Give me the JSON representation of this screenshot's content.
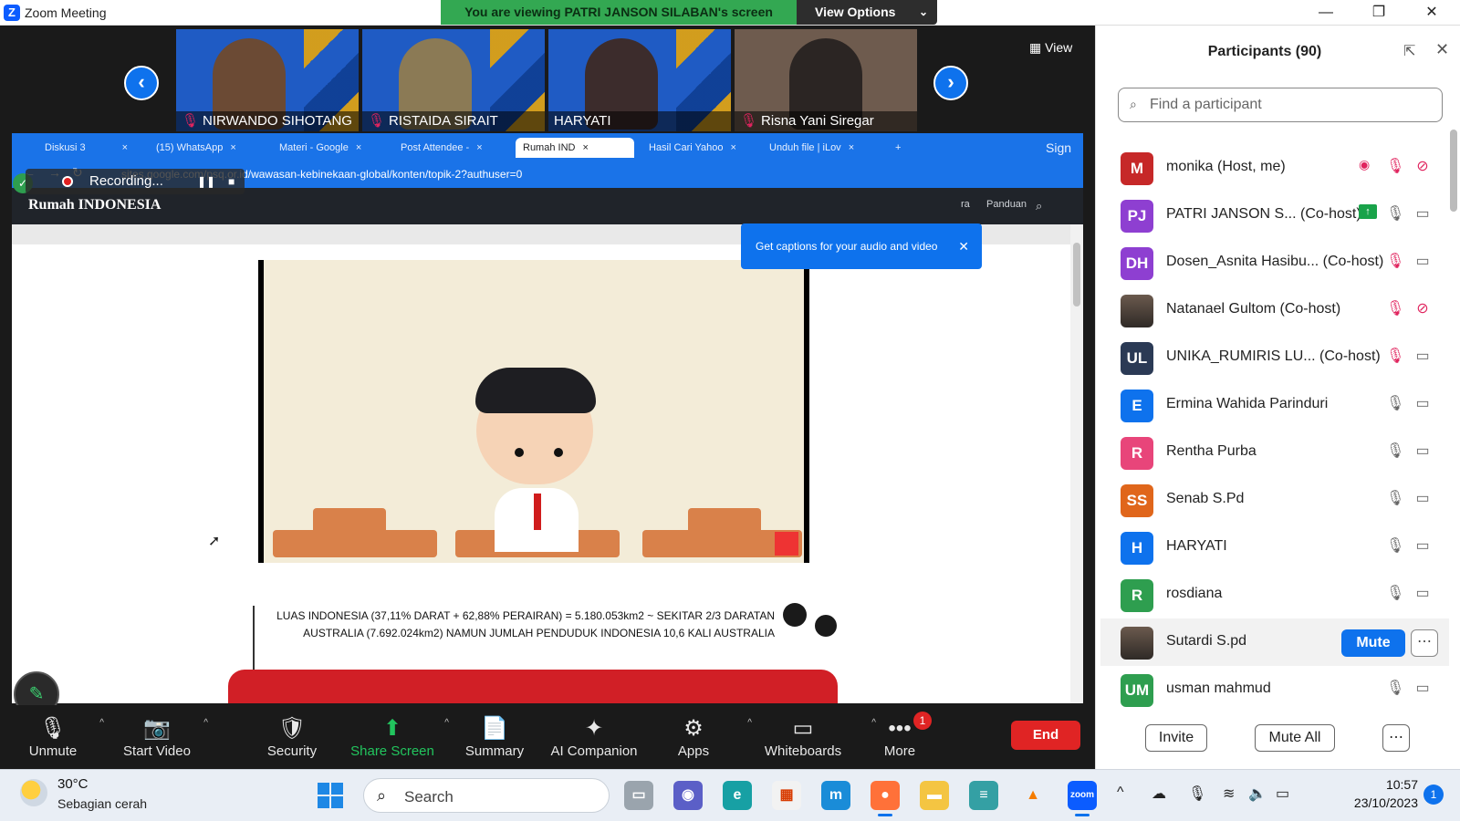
{
  "window": {
    "title": "Zoom Meeting",
    "viewing_banner": "You are viewing PATRI JANSON SILABAN's screen",
    "view_options": "View Options"
  },
  "stage": {
    "view_label": "View",
    "thumbnails": [
      {
        "name": "NIRWANDO SIHOTANG",
        "muted": true
      },
      {
        "name": "RISTAIDA SIRAIT",
        "muted": true
      },
      {
        "name": "HARYATI",
        "muted": false
      },
      {
        "name": "Risna Yani Siregar",
        "muted": true
      }
    ],
    "recording_label": "Recording...",
    "captions_tip": "Get captions for your audio and video"
  },
  "browser": {
    "tabs": [
      "Diskusi 3",
      "(15) WhatsApp",
      "Materi - Google",
      "Post Attendee -",
      "Rumah IND",
      "Hasil Cari Yahoo",
      "Unduh file | iLov"
    ],
    "sign_in": "Sign in",
    "url": "sites.google.com/psq.or.id/wawasan-kebinekaan-global/konten/topik-2?authuser=0",
    "site_brand": "Rumah INDONESIA",
    "site_links": [
      "ra",
      "Panduan"
    ],
    "slide_text_line1": "LUAS INDONESIA (37,11% DARAT + 62,88% PERAIRAN) = 5.180.053km2 ~ SEKITAR 2/3 DARATAN",
    "slide_text_line2": "AUSTRALIA (7.692.024km2) NAMUN JUMLAH PENDUDUK INDONESIA 10,6 KALI AUSTRALIA"
  },
  "toolbar": {
    "unmute": "Unmute",
    "start_video": "Start Video",
    "security": "Security",
    "share_screen": "Share Screen",
    "summary": "Summary",
    "ai_companion": "AI Companion",
    "apps": "Apps",
    "whiteboards": "Whiteboards",
    "more": "More",
    "more_badge": "1",
    "end": "End"
  },
  "participants": {
    "title": "Participants (90)",
    "search_placeholder": "Find a participant",
    "list": [
      {
        "initials": "M",
        "name": "monika (Host, me)",
        "color": "#c62828",
        "mic": "muted",
        "cam": "off",
        "extra": "rec"
      },
      {
        "initials": "PJ",
        "name": "PATRI JANSON S...  (Co-host)",
        "color": "#8e3fd1",
        "mic": "on",
        "cam": "on",
        "extra": "share"
      },
      {
        "initials": "DH",
        "name": "Dosen_Asnita Hasibu...  (Co-host)",
        "color": "#8e3fd1",
        "mic": "muted",
        "cam": "on"
      },
      {
        "initials": "",
        "name": "Natanael Gultom (Co-host)",
        "color": "photo",
        "mic": "muted",
        "cam": "off"
      },
      {
        "initials": "UL",
        "name": "UNIKA_RUMIRIS LU...  (Co-host)",
        "color": "#2b3a55",
        "mic": "muted",
        "cam": "on"
      },
      {
        "initials": "E",
        "name": "Ermina Wahida Parinduri",
        "color": "#0e72ed",
        "mic": "on",
        "cam": "on"
      },
      {
        "initials": "R",
        "name": "Rentha Purba",
        "color": "#e8457a",
        "mic": "on",
        "cam": "on"
      },
      {
        "initials": "SS",
        "name": "Senab S.Pd",
        "color": "#e0661b",
        "mic": "on",
        "cam": "on"
      },
      {
        "initials": "H",
        "name": "HARYATI",
        "color": "#0e72ed",
        "mic": "on",
        "cam": "on"
      },
      {
        "initials": "R",
        "name": "rosdiana",
        "color": "#2e9e4f",
        "mic": "on",
        "cam": "on"
      },
      {
        "initials": "",
        "name": "Sutardi S.pd",
        "color": "photo",
        "mic": "hover",
        "cam": "hover"
      },
      {
        "initials": "UM",
        "name": "usman mahmud",
        "color": "#2e9e4f",
        "mic": "on",
        "cam": "on"
      }
    ],
    "mute_label": "Mute",
    "invite": "Invite",
    "mute_all": "Mute All"
  },
  "taskbar": {
    "temp": "30°C",
    "weather": "Sebagian cerah",
    "search": "Search",
    "time": "10:57",
    "date": "23/10/2023",
    "notifications": "1"
  }
}
